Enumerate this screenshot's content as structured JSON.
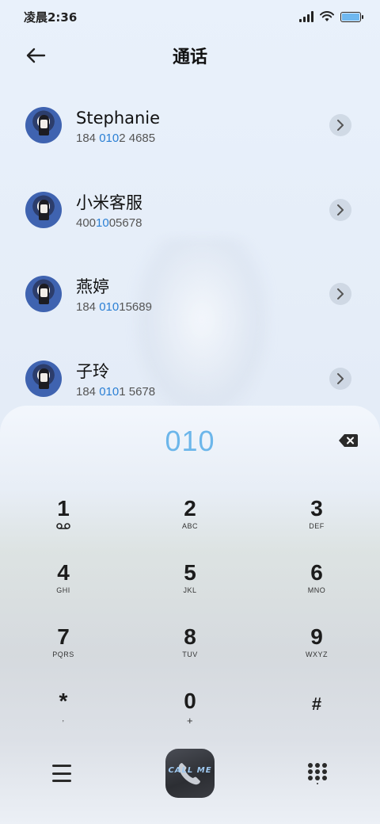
{
  "status_bar": {
    "time": "凌晨2:36",
    "icons": [
      "signal-icon",
      "wifi-icon",
      "battery-icon"
    ]
  },
  "header": {
    "title": "通话",
    "back_icon": "arrow-left-icon"
  },
  "contacts": [
    {
      "name": "Stephanie",
      "number_pre": "184 ",
      "number_hl": "010",
      "number_post": "2 4685"
    },
    {
      "name": "小米客服",
      "number_pre": "400",
      "number_hl": "10",
      "number_post": "05678"
    },
    {
      "name": "燕婷",
      "number_pre": "184 ",
      "number_hl": "010",
      "number_post": "15689"
    },
    {
      "name": "子玲",
      "number_pre": "184 ",
      "number_hl": "010",
      "number_post": "1 5678"
    }
  ],
  "dialpad": {
    "input": "010",
    "keys": [
      {
        "num": "1",
        "sub": ""
      },
      {
        "num": "2",
        "sub": "ABC"
      },
      {
        "num": "3",
        "sub": "DEF"
      },
      {
        "num": "4",
        "sub": "GHI"
      },
      {
        "num": "5",
        "sub": "JKL"
      },
      {
        "num": "6",
        "sub": "MNO"
      },
      {
        "num": "7",
        "sub": "PQRS"
      },
      {
        "num": "8",
        "sub": "TUV"
      },
      {
        "num": "9",
        "sub": "WXYZ"
      },
      {
        "num": "*",
        "sub": ","
      },
      {
        "num": "0",
        "sub": "+"
      },
      {
        "num": "#",
        "sub": ""
      }
    ]
  },
  "bottom": {
    "call_label": "CALL ME"
  },
  "colors": {
    "highlight": "#2a7fd4",
    "input": "#6cb6ea",
    "battery_fill": "#6fb8f0"
  }
}
